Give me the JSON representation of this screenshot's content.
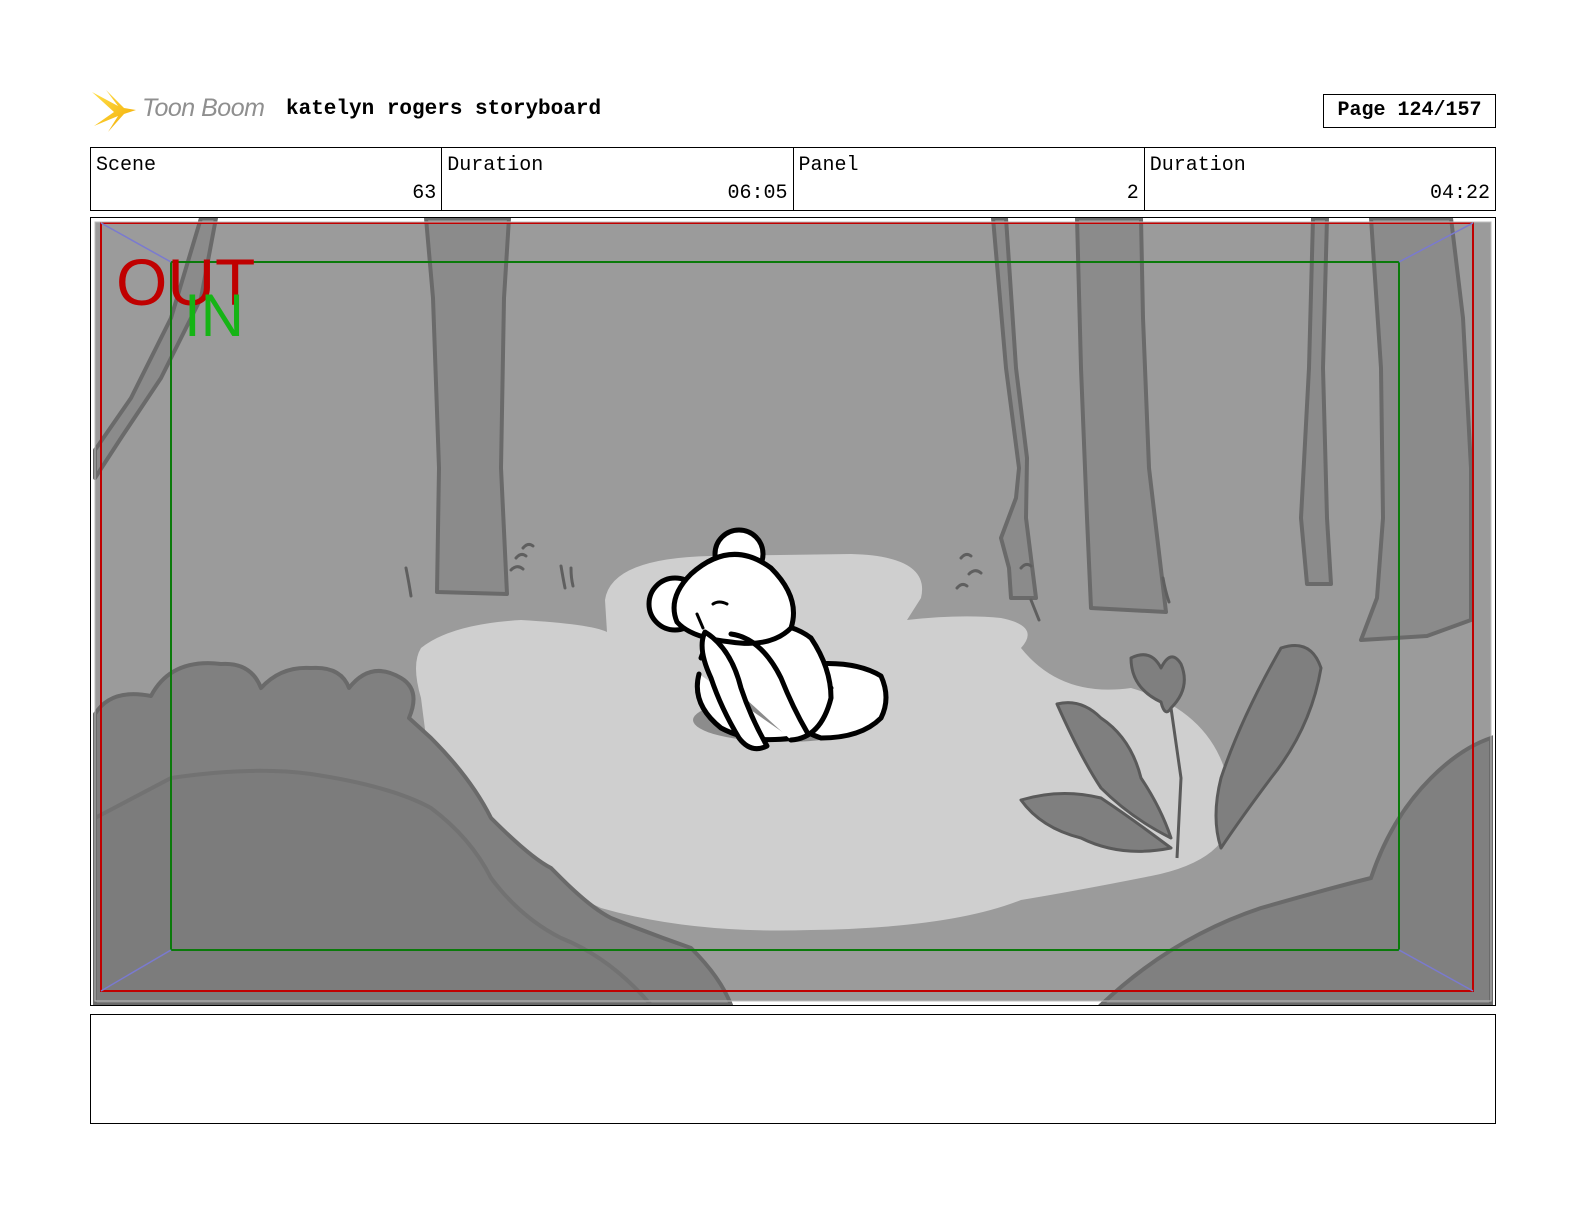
{
  "header": {
    "logo_text": "Toon Boom",
    "title": "katelyn rogers storyboard",
    "page": "Page 124/157"
  },
  "info": {
    "scene_label": "Scene",
    "scene_value": "63",
    "scene_duration_label": "Duration",
    "scene_duration_value": "06:05",
    "panel_label": "Panel",
    "panel_value": "2",
    "panel_duration_label": "Duration",
    "panel_duration_value": "04:22"
  },
  "frame": {
    "out_marker": "OUT",
    "in_marker": "IN",
    "colors": {
      "out_frame": "#c00000",
      "in_frame": "#0a7a0a",
      "corner_lines": "#7a7ad0"
    }
  },
  "notes": {
    "text": ""
  }
}
